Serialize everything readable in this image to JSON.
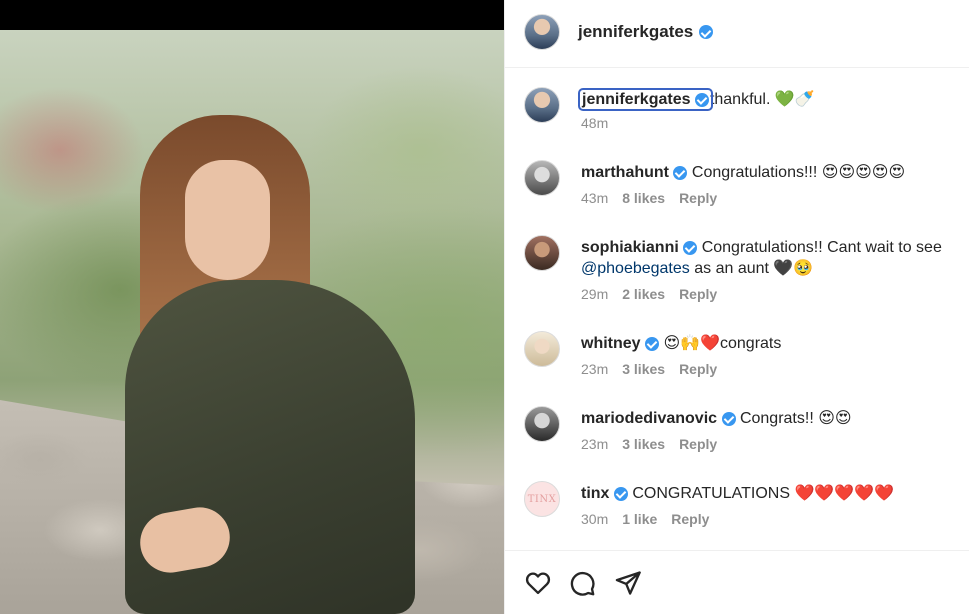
{
  "post": {
    "author": "jenniferkgates",
    "verified": true
  },
  "caption": {
    "user": "jenniferkgates",
    "text": "thankful. 💚🍼",
    "time": "48m"
  },
  "comments": [
    {
      "user": "marthahunt",
      "text": "Congratulations!!! 😍😍😍😍😍",
      "time": "43m",
      "likes": "8 likes",
      "reply": "Reply"
    },
    {
      "user": "sophiakianni",
      "text_before": "Congratulations!! Cant wait to see ",
      "mention": "@phoebegates",
      "text_after": " as an aunt 🖤🥹",
      "time": "29m",
      "likes": "2 likes",
      "reply": "Reply"
    },
    {
      "user": "whitney",
      "text": "😍🙌❤️congrats",
      "time": "23m",
      "likes": "3 likes",
      "reply": "Reply"
    },
    {
      "user": "mariodedivanovic",
      "text": "Congrats!! 😍😍",
      "time": "23m",
      "likes": "3 likes",
      "reply": "Reply"
    },
    {
      "user": "tinx",
      "text": "CONGRATULATIONS ❤️❤️❤️❤️❤️",
      "time": "30m",
      "likes": "1 like",
      "reply": "Reply",
      "avatar_text": "TINX"
    }
  ],
  "actions": {
    "icons": [
      "heart-icon",
      "comment-icon",
      "share-icon"
    ]
  },
  "colors": {
    "verified": "#3897f0",
    "mention": "#00376b",
    "meta": "#8e8e8e",
    "focus_outline": "#3a63c4"
  }
}
